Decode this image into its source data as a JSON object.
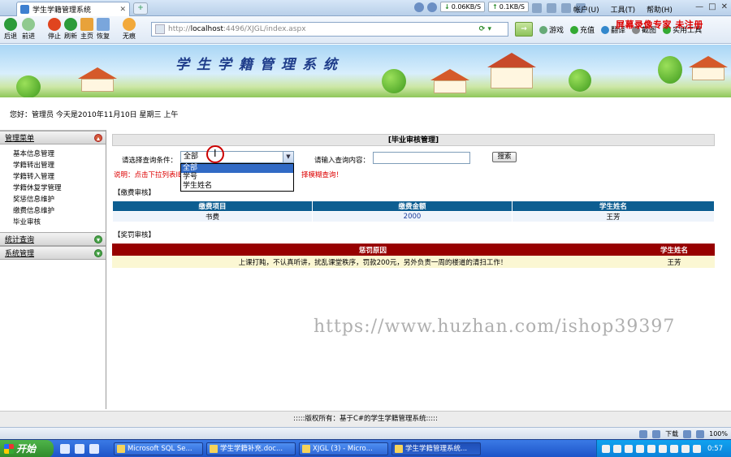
{
  "browser": {
    "tab_title": "学生学籍管理系统",
    "net_down": "0.06KB/S",
    "net_up": "0.1KB/S",
    "menu": [
      "帐户(U)",
      "工具(T)",
      "帮助(H)"
    ],
    "nav_buttons": [
      "后退",
      "前进",
      "停止",
      "刷新",
      "主页",
      "恢复",
      "无痕"
    ],
    "address_prefix": "http://",
    "address_host": "localhost",
    "address_rest": ":4496/XJGL/index.aspx",
    "tools": [
      "游戏",
      "充值",
      "翻译",
      "截图",
      "实用工具"
    ],
    "recorder_watermark": "屏幕录像专家 未注册"
  },
  "banner": {
    "title": "学生学籍管理系统"
  },
  "greeting": "您好：管理员    今天是2010年11月10日    星期三    上午",
  "sidebar": {
    "groups": [
      {
        "label": "管理菜单",
        "state": "open"
      },
      {
        "label": "统计查询",
        "state": "closed"
      },
      {
        "label": "系统管理",
        "state": "closed"
      }
    ],
    "items": [
      "基本信息管理",
      "学籍转出管理",
      "学籍转入管理",
      "学籍休复学管理",
      "奖惩信息维护",
      "缴费信息维护",
      "毕业审核"
    ]
  },
  "main": {
    "panel_title": "[毕业审核管理]",
    "query_label": "请选择查询条件：",
    "query_selected": "全部",
    "query_options": [
      "全部",
      "学号",
      "学生姓名"
    ],
    "keyword_label": "请输入查询内容：",
    "keyword_value": "",
    "search_button": "搜索",
    "hint": "说明：点击下拉列表IE",
    "hint_tail": "择模糊查询！",
    "fee_section_title": "【缴费审核】",
    "fee_table": {
      "headers": [
        "缴费项目",
        "缴费金额",
        "学生姓名"
      ],
      "rows": [
        [
          "书费",
          "2000",
          "王芳"
        ]
      ]
    },
    "award_section_title": "【奖罚审核】",
    "award_table": {
      "headers": [
        "惩罚原因",
        "学生姓名"
      ],
      "rows": [
        [
          "上课打盹，不认真听讲，扰乱课堂秩序，罚款200元，另外负责一周的楼道的清扫工作！",
          "王芳"
        ]
      ]
    }
  },
  "site_watermark": "https://www.huzhan.com/ishop39397",
  "footer": ":::::版权所有：基于C#的学生学籍管理系统:::::",
  "statusbar": {
    "zoom": "100%",
    "download": "下载"
  },
  "taskbar": {
    "start": "开始",
    "tasks": [
      "Microsoft SQL Se...",
      "学生学籍补充.doc...",
      "XJGL (3) - Micro...",
      "学生学籍管理系统..."
    ],
    "clock": "0:57"
  }
}
